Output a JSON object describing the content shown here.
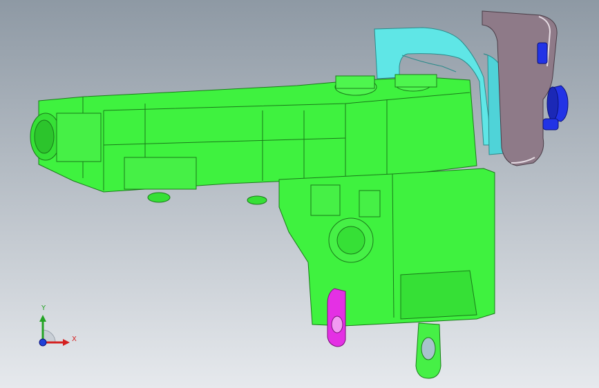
{
  "viewport": {
    "background_top": "#8e99a4",
    "background_bottom": "#e6e9ed"
  },
  "model": {
    "parts": [
      {
        "name": "main-housing",
        "color": "#3ff23f",
        "edge": "#1a7a1a"
      },
      {
        "name": "mounting-bracket",
        "color": "#5fe6e6",
        "edge": "#2a8a8a"
      },
      {
        "name": "clip-plate",
        "color": "#8e7a88",
        "edge": "#4a3c46"
      },
      {
        "name": "connector-pin",
        "color": "#2233e6",
        "edge": "#0b137a"
      },
      {
        "name": "hinge-pivot",
        "color": "#e430e4",
        "edge": "#7a107a"
      }
    ]
  },
  "triad": {
    "x_label": "X",
    "y_label": "Y",
    "x_color": "#d42020",
    "y_color": "#24a424",
    "z_color": "#2040d8"
  }
}
